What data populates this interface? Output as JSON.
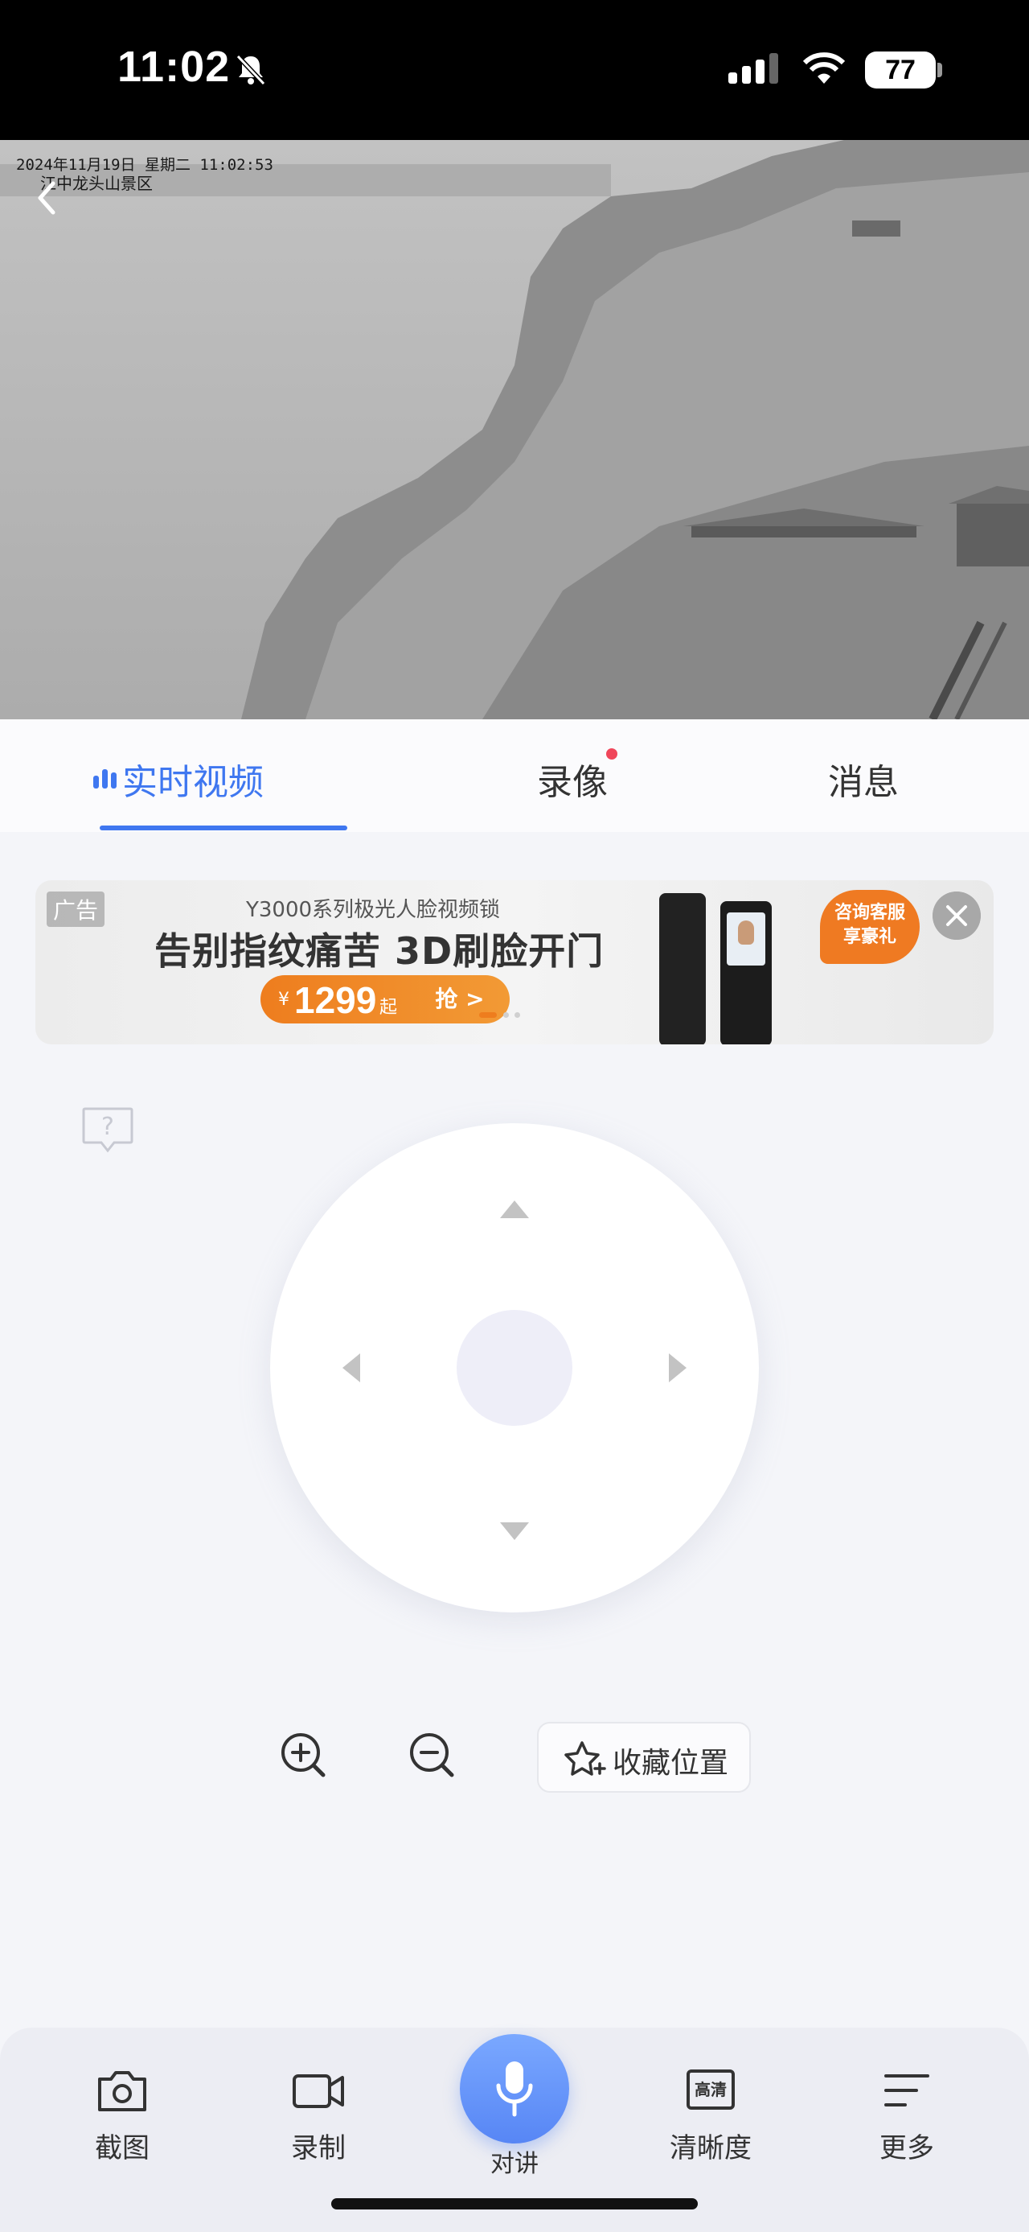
{
  "status_bar": {
    "time": "11:02",
    "battery": "77"
  },
  "video": {
    "osd_datetime": "2024年11月19日  星期二  11:02:53",
    "osd_location": "江中龙头山景区"
  },
  "tabs": [
    {
      "label": "实时视频",
      "active": true
    },
    {
      "label": "录像",
      "badge": true
    },
    {
      "label": "消息"
    }
  ],
  "ad": {
    "tag": "广告",
    "subtitle": "Y3000系列极光人脸视频锁",
    "title": "告别指纹痛苦 3D刷脸开门",
    "currency": "¥",
    "price": "1299",
    "price_suffix": "起",
    "buy_label": "抢 >",
    "bubble_line1": "咨询客服",
    "bubble_line2": "享豪礼",
    "accent_color": "#ee7d1e"
  },
  "controls": {
    "favorite_label": "收藏位置"
  },
  "bottom_bar": {
    "screenshot_label": "截图",
    "record_label": "录制",
    "talk_label": "对讲",
    "hd_label": "清晰度",
    "hd_icon_text": "高清",
    "more_label": "更多"
  },
  "colors": {
    "accent": "#3f77f0",
    "badge": "#f0465a"
  }
}
